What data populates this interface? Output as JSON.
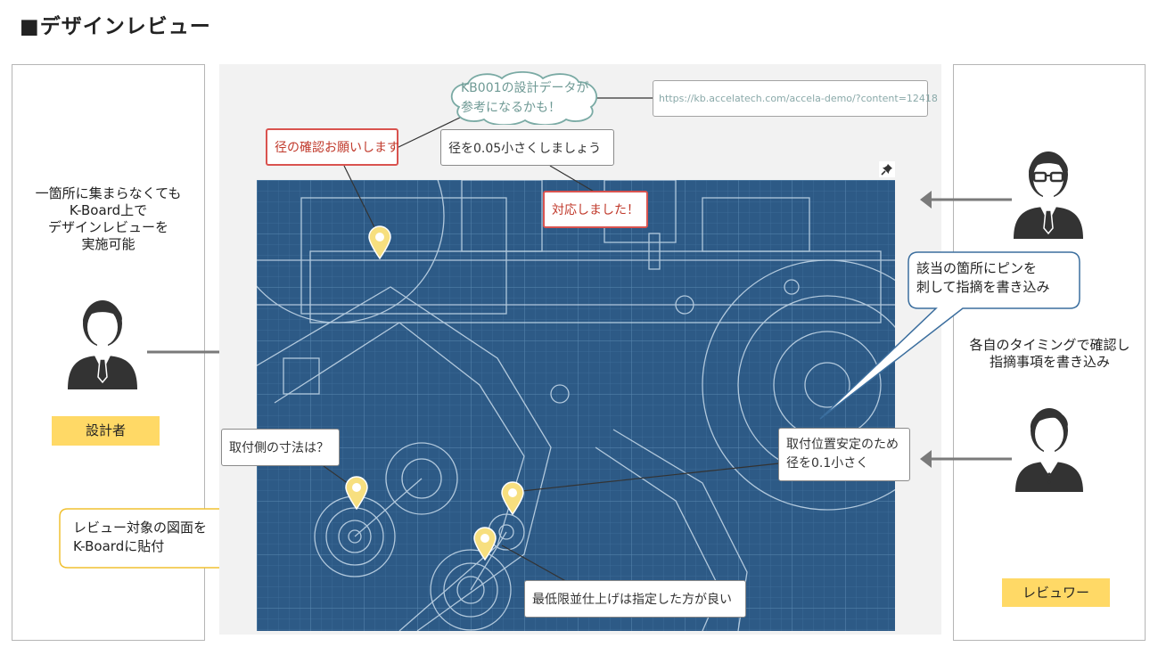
{
  "title": "■デザインレビュー",
  "left": {
    "description_lines": [
      "一箇所に集まらなくても",
      "K-Board上で",
      "デザインレビューを",
      "実施可能"
    ],
    "role": "設計者",
    "callout_lines": [
      "レビュー対象の図面を",
      "K-Boardに貼付"
    ]
  },
  "right": {
    "callout_lines": [
      "該当の箇所にピンを",
      "刺して指摘を書き込み"
    ],
    "description_lines": [
      "各自のタイミングで確認し",
      "指摘事項を書き込み"
    ],
    "role": "レビュワー"
  },
  "board": {
    "cloud_lines": [
      "KB001の設計データが",
      "参考になるかも！"
    ],
    "url": "https://kb.accelatech.com/accela-demo/?content=12418",
    "notes": {
      "diameter_check": "径の確認お願いします",
      "reduce_005": "径を0.05小さくしましょう",
      "done": "対応しました！",
      "mount_dimension": "取付側の寸法は？",
      "stability_line1": "取付位置安定のため",
      "stability_line2": "径を0.1小さく",
      "minimum_finish": "最低限並仕上げは指定した方が良い"
    }
  },
  "colors": {
    "role_bg": "#ffd966",
    "board_bg": "#2d5a86",
    "red_note": "#d9534f",
    "blue_callout": "#3b6e9e",
    "yellow_callout": "#f0c030",
    "pin": "#f7df7f"
  }
}
